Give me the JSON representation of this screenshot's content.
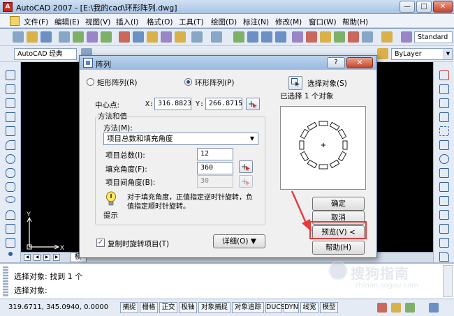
{
  "window": {
    "title": "AutoCAD 2007 - [E:\\我的cad\\环形阵列.dwg]",
    "min_label": "—",
    "max_label": "□",
    "close_label": "✕"
  },
  "menu": [
    "文件(F)",
    "编辑(E)",
    "视图(V)",
    "插入(I)",
    "格式(O)",
    "工具(T)",
    "绘图(D)",
    "标注(N)",
    "修改(M)",
    "窗口(W)",
    "帮助(H)"
  ],
  "toolbar": {
    "workspace": "AutoCAD 经典",
    "text_style": "Standard",
    "layer": "ByLayer"
  },
  "command": {
    "line1": "选择对象: 找到 1 个",
    "line2": "选择对象:"
  },
  "status": {
    "coords": "319.6711, 345.0940, 0.0000",
    "buttons": [
      "捕捉",
      "栅格",
      "正交",
      "极轴",
      "对象捕捉",
      "对象追踪",
      "DUCS",
      "DYN",
      "线宽",
      "模型"
    ]
  },
  "model_tab": "模",
  "ucs": {
    "x_label": "X",
    "y_label": "Y"
  },
  "dialog": {
    "title": "阵列",
    "help_btn": "?",
    "close_btn": "✕",
    "rect_array": "矩形阵列(R)",
    "polar_array": "环形阵列(P)",
    "center_label": "中心点:",
    "x_label": "X:",
    "x_value": "316.8823",
    "y_label": "Y:",
    "y_value": "266.8715",
    "method_group": "方法和值",
    "method_label": "方法(M):",
    "method_value": "项目总数和填充角度",
    "total_items_label": "项目总数(I):",
    "total_items_value": "12",
    "fill_angle_label": "填充角度(F):",
    "fill_angle_value": "360",
    "item_angle_label": "项目间角度(B):",
    "item_angle_value": "30",
    "tip_text_1": "对于填充角度，正值指定逆时针旋转，负",
    "tip_text_2": "值指定顺时针旋转。",
    "tip_label": "提示",
    "rotate_items": "复制时旋转项目(T)",
    "details_btn": "详细(O) ▼",
    "select_objects": "选择对象(S)",
    "selected_count": "已选择 1 个对象",
    "ok": "确定",
    "cancel": "取消",
    "preview": "预览(V) <",
    "help": "帮助(H)"
  },
  "watermark": {
    "text": "搜狗指南",
    "url": "zhinan.sogou.com"
  }
}
